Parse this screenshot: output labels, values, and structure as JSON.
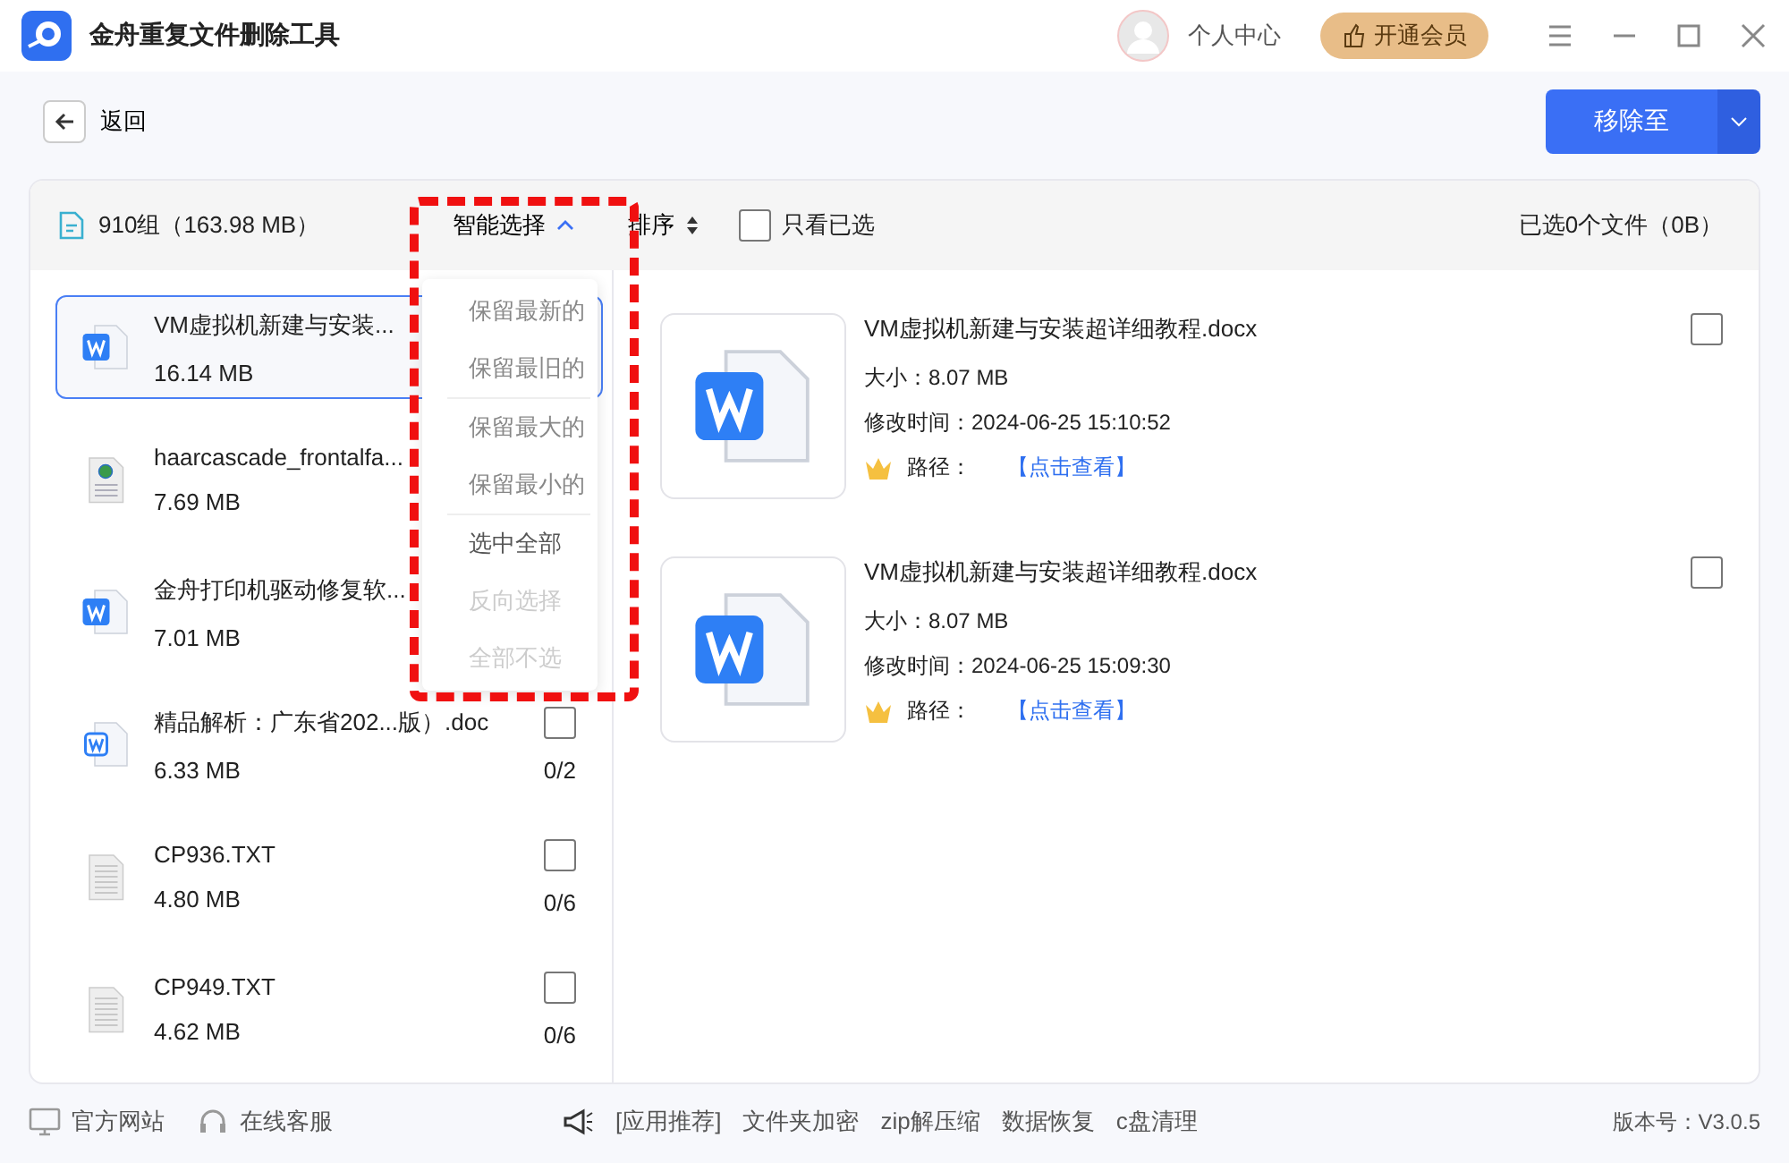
{
  "window": {
    "title": "金舟重复文件删除工具",
    "user_label": "个人中心",
    "vip_label": "开通会员"
  },
  "toolbar": {
    "back_label": "返回",
    "move_label": "移除至"
  },
  "summary": {
    "groups": "910组（163.98 MB）",
    "smart_select": "智能选择",
    "sort": "排序",
    "only_selected": {
      "label": "只看已选",
      "checked": false
    },
    "selected_count": "已选0个文件（0B）"
  },
  "dropdown": {
    "items": [
      {
        "label": "保留最新的",
        "disabled": false,
        "divider_after": false
      },
      {
        "label": "保留最旧的",
        "disabled": false,
        "divider_after": true
      },
      {
        "label": "保留最大的",
        "disabled": false,
        "divider_after": false
      },
      {
        "label": "保留最小的",
        "disabled": false,
        "divider_after": true
      },
      {
        "label": "选中全部",
        "disabled": false,
        "divider_after": false
      },
      {
        "label": "反向选择",
        "disabled": true,
        "divider_after": false
      },
      {
        "label": "全部不选",
        "disabled": true,
        "divider_after": false
      }
    ]
  },
  "groups": [
    {
      "name": "VM虚拟机新建与安装...",
      "size": "16.14 MB",
      "kind": "word",
      "selected": true
    },
    {
      "name": "haarcascade_frontalfa...",
      "size": "7.69 MB",
      "kind": "web",
      "selected": false
    },
    {
      "name": "金舟打印机驱动修复软...",
      "size": "7.01 MB",
      "kind": "word",
      "selected": false
    },
    {
      "name": "精品解析：广东省202...版）.doc",
      "size": "6.33 MB",
      "kind": "doc",
      "selected": false,
      "checked": false,
      "count": "0/2"
    },
    {
      "name": "CP936.TXT",
      "size": "4.80 MB",
      "kind": "text",
      "selected": false,
      "checked": false,
      "count": "0/6"
    },
    {
      "name": "CP949.TXT",
      "size": "4.62 MB",
      "kind": "text",
      "selected": false,
      "checked": false,
      "count": "0/6"
    }
  ],
  "files": [
    {
      "name": "VM虚拟机新建与安装超详细教程.docx",
      "size": "大小：8.07 MB",
      "mtime": "修改时间：2024-06-25 15:10:52",
      "path_label": "路径：",
      "path_link": "【点击查看】",
      "checked": false
    },
    {
      "name": "VM虚拟机新建与安装超详细教程.docx",
      "size": "大小：8.07 MB",
      "mtime": "修改时间：2024-06-25 15:09:30",
      "path_label": "路径：",
      "path_link": "【点击查看】",
      "checked": false
    }
  ],
  "footer": {
    "website": "官方网站",
    "support": "在线客服",
    "promo": [
      "[应用推荐]",
      "文件夹加密",
      "zip解压缩",
      "数据恢复",
      "c盘清理"
    ],
    "version": "版本号：V3.0.5"
  }
}
